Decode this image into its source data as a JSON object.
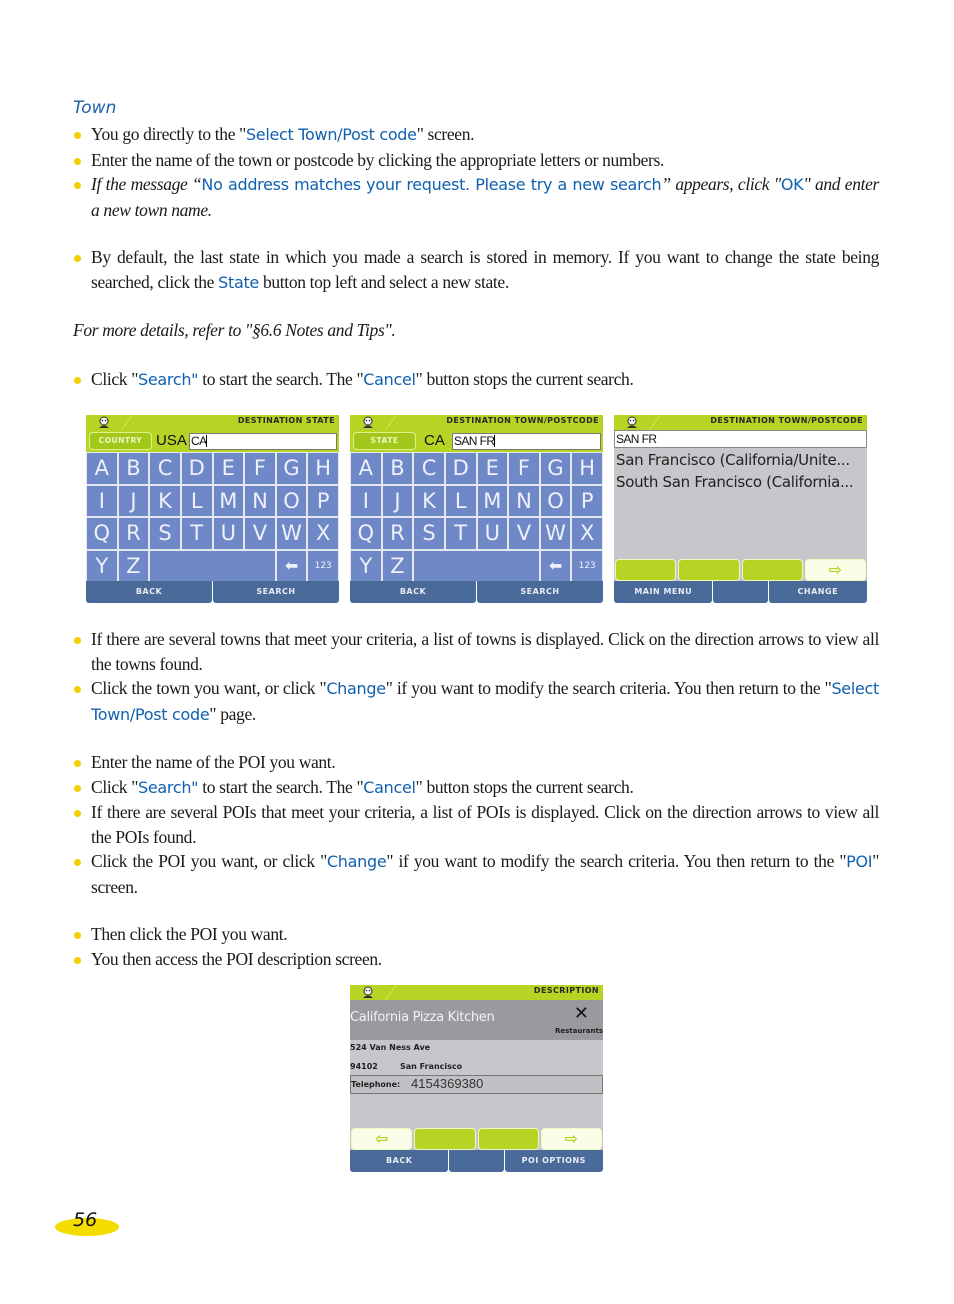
{
  "section_heading": "Town",
  "paragraphs": {
    "p1": {
      "before": "You go directly to the \"",
      "kw": "Select Town/Post code",
      "after": "\" screen."
    },
    "p2": "Enter the name of the town or postcode by clicking the appropriate letters or numbers.",
    "p3": {
      "before": "If the message “",
      "kw": "No address matches your request. Please try a new search",
      "mid": "” appears, click \"",
      "kw2": "OK",
      "after": "\" and enter a new town name."
    },
    "p4": {
      "before": "By default, the last state in which you made a search is stored in memory. If you want to change the state being searched, click the ",
      "kw": "State",
      "after": " button top left and select a new state."
    },
    "note": "For more details, refer to \"§6.6 Notes and Tips\".",
    "p5": {
      "before": "Click \"",
      "kw": "Search\"",
      "mid": " to start the search. The \"",
      "kw2": "Cancel",
      "after": "\" button stops the current search."
    },
    "p6": "If there are several towns that meet your criteria, a list of towns is displayed. Click on the direction arrows to view all the towns found.",
    "p7": {
      "before": "Click the town you want, or click \"",
      "kw": "Change",
      "mid": "\" if you want to modify the search criteria. You then return to the \"",
      "kw2": "Select Town/Post code",
      "after": "\" page."
    },
    "p8": "Enter the name of the POI you want.",
    "p9": {
      "before": "Click \"",
      "kw": "Search\"",
      "mid": " to start the search. The \"",
      "kw2": "Cancel",
      "after": "\" button stops the current search."
    },
    "p10": "If there are several POIs that meet your criteria, a list of POIs is displayed. Click on the direction arrows to view all the POIs found.",
    "p11": {
      "before": "Click the POI you want, or click \"",
      "kw": "Change",
      "mid": "\" if you want to modify the search criteria. You then return to the \"",
      "kw2": "POI",
      "after": "\" screen."
    },
    "p12": "Then click the POI you want.",
    "p13": "You then access the POI description screen."
  },
  "screens": {
    "state": {
      "title": "DESTINATION STATE",
      "mode_button": "COUNTRY",
      "mode_value": "USA",
      "input": "CA",
      "keys": [
        "A",
        "B",
        "C",
        "D",
        "E",
        "F",
        "G",
        "H",
        "I",
        "J",
        "K",
        "L",
        "M",
        "N",
        "O",
        "P",
        "Q",
        "R",
        "S",
        "T",
        "U",
        "V",
        "W",
        "X",
        "Y",
        "Z"
      ],
      "backspace": "⬅",
      "numeric": "123",
      "bottom": [
        "BACK",
        "SEARCH"
      ]
    },
    "town": {
      "title": "DESTINATION TOWN/POSTCODE",
      "mode_button": "STATE",
      "mode_value": "CA",
      "input": "SAN FR",
      "keys": [
        "A",
        "B",
        "C",
        "D",
        "E",
        "F",
        "G",
        "H",
        "I",
        "J",
        "K",
        "L",
        "M",
        "N",
        "O",
        "P",
        "Q",
        "R",
        "S",
        "T",
        "U",
        "V",
        "W",
        "X",
        "Y",
        "Z"
      ],
      "backspace": "⬅",
      "numeric": "123",
      "bottom": [
        "BACK",
        "SEARCH"
      ]
    },
    "results": {
      "title": "DESTINATION TOWN/POSTCODE",
      "input": "SAN FR",
      "results": [
        "San Francisco (California/Unite...",
        "South San Francisco (California..."
      ],
      "next_arrow": "⇨",
      "bottom": [
        "MAIN MENU",
        "",
        "CHANGE"
      ]
    },
    "description": {
      "title": "DESCRIPTION",
      "poi_name": "California Pizza Kitchen",
      "category": "Restaurants",
      "category_icon": "restaurant-icon",
      "address": "524 Van Ness Ave",
      "postcode": "94102",
      "city": "San Francisco",
      "telephone_label": "Telephone:",
      "telephone": "4154369380",
      "prev_arrow": "⇦",
      "next_arrow": "⇨",
      "bottom": [
        "BACK",
        "",
        "POI OPTIONS"
      ]
    }
  },
  "page_number": "56"
}
